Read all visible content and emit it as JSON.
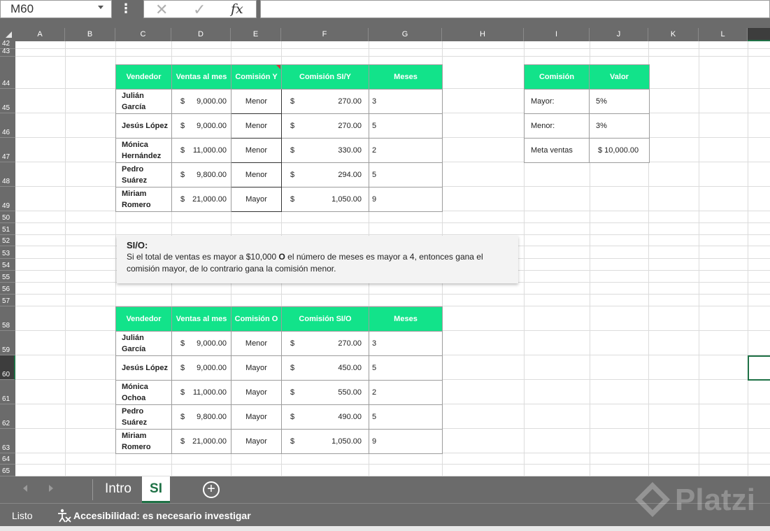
{
  "formula_bar": {
    "name_box": "M60",
    "dots": "⋮",
    "cancel_icon": "✕",
    "enter_icon": "✓",
    "fx_icon": "fx",
    "formula_value": ""
  },
  "columns": [
    "A",
    "B",
    "C",
    "D",
    "E",
    "F",
    "G",
    "H",
    "I",
    "J",
    "K",
    "L"
  ],
  "rows": [
    "42",
    "43",
    "44",
    "45",
    "46",
    "47",
    "48",
    "49",
    "50",
    "51",
    "52",
    "53",
    "54",
    "55",
    "56",
    "57",
    "58",
    "59",
    "60",
    "61",
    "62",
    "63",
    "64",
    "65"
  ],
  "table_y": {
    "headers": [
      "Vendedor",
      "Ventas al mes",
      "Comisión Y",
      "Comisión SI/Y",
      "Meses"
    ],
    "rows": [
      {
        "vendedor": "Julián García",
        "ventas": "9,000.00",
        "comision": "Menor",
        "monto": "270.00",
        "meses": "3"
      },
      {
        "vendedor": "Jesús López",
        "ventas": "9,000.00",
        "comision": "Menor",
        "monto": "270.00",
        "meses": "5"
      },
      {
        "vendedor": "Mónica Hernández",
        "ventas": "11,000.00",
        "comision": "Menor",
        "monto": "330.00",
        "meses": "2"
      },
      {
        "vendedor": "Pedro Suárez",
        "ventas": "9,800.00",
        "comision": "Menor",
        "monto": "294.00",
        "meses": "5"
      },
      {
        "vendedor": "Miriam Romero",
        "ventas": "21,000.00",
        "comision": "Mayor",
        "monto": "1,050.00",
        "meses": "9"
      }
    ]
  },
  "table_params": {
    "headers": [
      "Comisión",
      "Valor"
    ],
    "rows": [
      {
        "label": "Mayor:",
        "value": "5%"
      },
      {
        "label": "Menor:",
        "value": "3%"
      },
      {
        "label": "Meta ventas",
        "value": "$ 10,000.00"
      }
    ]
  },
  "note": {
    "title": "SI/O:",
    "line1_a": "Si  el total de ventas es mayor a $10,000 ",
    "line1_b": "O",
    "line1_c": " el número de meses es mayor a 4, entonces gana el",
    "line2": "comisión mayor, de lo contrario gana la comisión menor."
  },
  "table_o": {
    "headers": [
      "Vendedor",
      "Ventas al mes",
      "Comisión O",
      "Comisión SI/O",
      "Meses"
    ],
    "rows": [
      {
        "vendedor": "Julián García",
        "ventas": "9,000.00",
        "comision": "Menor",
        "monto": "270.00",
        "meses": "3"
      },
      {
        "vendedor": "Jesús López",
        "ventas": "9,000.00",
        "comision": "Mayor",
        "monto": "450.00",
        "meses": "5"
      },
      {
        "vendedor": "Mónica Ochoa",
        "ventas": "11,000.00",
        "comision": "Mayor",
        "monto": "550.00",
        "meses": "2"
      },
      {
        "vendedor": "Pedro Suárez",
        "ventas": "9,800.00",
        "comision": "Mayor",
        "monto": "490.00",
        "meses": "5"
      },
      {
        "vendedor": "Miriam Romero",
        "ventas": "21,000.00",
        "comision": "Mayor",
        "monto": "1,050.00",
        "meses": "9"
      }
    ]
  },
  "currency_symbol": "$",
  "sheet_tabs": [
    {
      "label": "Intro",
      "active": false
    },
    {
      "label": "SI",
      "active": true
    }
  ],
  "add_sheet_icon": "+",
  "status": {
    "ready": "Listo",
    "accessibility": "Accesibilidad: es necesario investigar"
  },
  "watermark": "Platzi",
  "colors": {
    "header_green": "#12e38a",
    "accent_green": "#1e7145",
    "chrome_gray": "#6b6b6b"
  }
}
